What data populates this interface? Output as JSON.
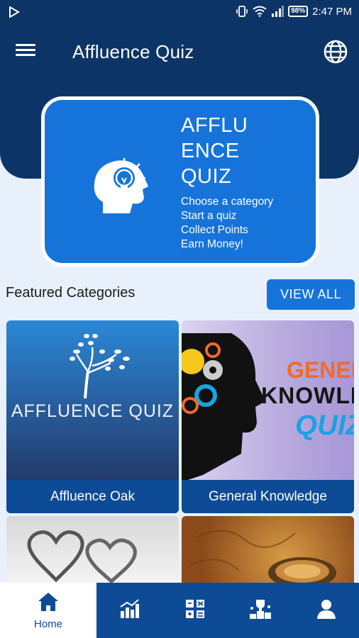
{
  "status_bar": {
    "battery": "98%",
    "time": "2:47 PM",
    "icons": [
      "play-store-icon",
      "vibrate-icon",
      "wifi-icon",
      "signal-icon",
      "battery-icon"
    ]
  },
  "app_bar": {
    "title": "Affluence Quiz",
    "menu_icon": "hamburger-menu-icon",
    "language_icon": "globe-icon"
  },
  "hero": {
    "title_lines": [
      "AFFLU",
      "ENCE",
      "QUIZ"
    ],
    "lines": [
      "Choose a category",
      "Start a quiz",
      "Collect Points",
      "Earn Money!"
    ],
    "icon": "head-lightbulb-icon"
  },
  "featured": {
    "title": "Featured Categories",
    "view_all": "VIEW ALL",
    "categories": [
      {
        "label": "Affluence Oak",
        "image_text": "AFFLUENCE QUIZ"
      },
      {
        "label": "General Knowledge",
        "image_text": [
          "GENER",
          "KNOWLE",
          "QUIZ"
        ]
      },
      {
        "label": "",
        "image": "hearts-image"
      },
      {
        "label": "",
        "image": "map-compass-image"
      }
    ]
  },
  "bottom_nav": {
    "items": [
      {
        "label": "Home",
        "icon": "home-icon",
        "active": true
      },
      {
        "label": "",
        "icon": "leaderboard-chart-icon"
      },
      {
        "label": "",
        "icon": "categories-grid-icon"
      },
      {
        "label": "",
        "icon": "trophy-podium-icon"
      },
      {
        "label": "",
        "icon": "profile-icon"
      }
    ]
  },
  "colors": {
    "header": "#0d3466",
    "primary": "#1673da",
    "nav": "#0d4b96",
    "background": "#e8f1fb"
  }
}
